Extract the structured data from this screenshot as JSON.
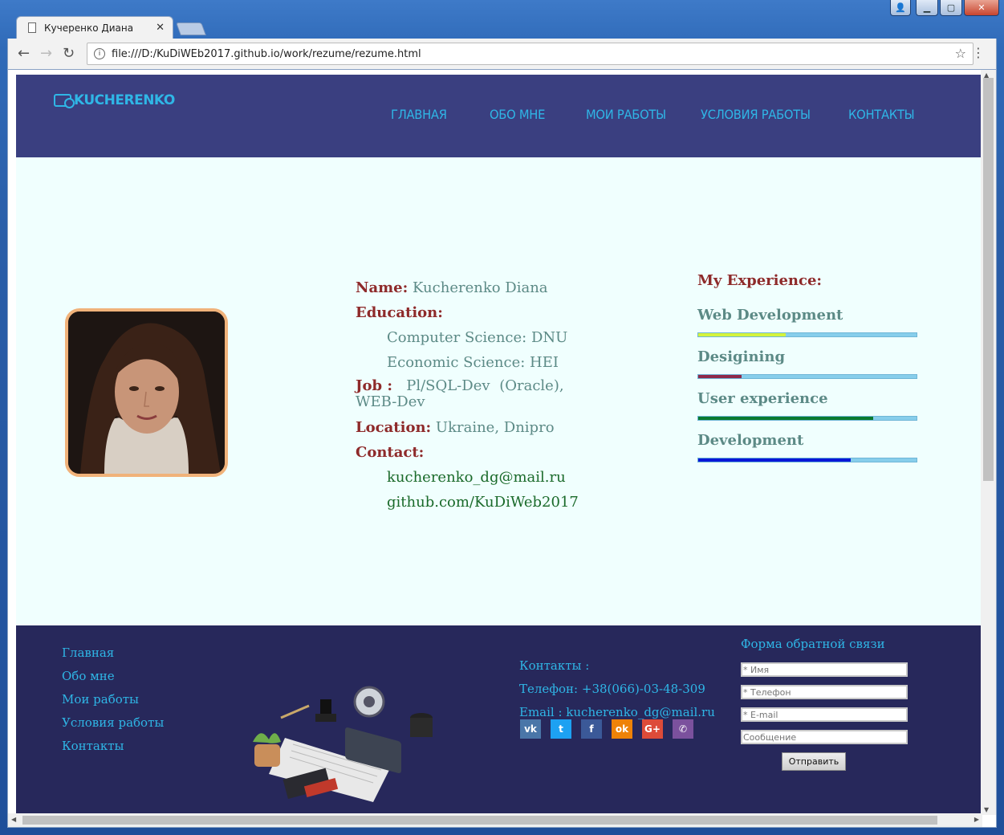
{
  "browser": {
    "tab_title": "Кучеренко Диана",
    "tab_close": "✕",
    "url": "file:///D:/KuDiWEb2017.github.io/work/rezume/rezume.html"
  },
  "header": {
    "logo_text": "KUCHERENKO",
    "menu": [
      "ГЛАВНАЯ",
      "ОБО МНЕ",
      "МОИ РАБОТЫ",
      "УСЛОВИЯ РАБОТЫ",
      "КОНТАКТЫ"
    ]
  },
  "profile": {
    "name_label": "Name:",
    "name": "Kucherenko Diana",
    "education_label": "Education:",
    "education": [
      "Computer Science: DNU",
      "Economic Science: HEI"
    ],
    "job_label": "Job :",
    "job": "Pl/SQL-Dev (Oracle), WEB-Dev",
    "location_label": "Location:",
    "location": "Ukraine, Dnipro",
    "contact_label": "Contact:",
    "email": "kucherenko_dg@mail.ru",
    "github": "github.com/KuDiWeb2017"
  },
  "experience": {
    "title": "My Experience:",
    "skills": [
      {
        "name": "Web Development",
        "level": 0.4,
        "color": "#d4f33c"
      },
      {
        "name": "Desigining",
        "level": 0.2,
        "color": "#8e2a4a"
      },
      {
        "name": "User experience",
        "level": 0.8,
        "color": "#0a7a30"
      },
      {
        "name": "Development",
        "level": 0.7,
        "color": "#0a18d8"
      }
    ],
    "track_color": "#87ceeb"
  },
  "footer": {
    "nav": [
      "Главная",
      "Обо мне",
      "Мои работы",
      "Условия работы",
      "Контакты"
    ],
    "contacts_title": "Контакты :",
    "phone": "Телефон: +38(066)-03-48-309",
    "email": "Email : kucherenko_dg@mail.ru",
    "socials": [
      {
        "icon": "vk-icon",
        "glyph": "vk",
        "color": "#4a76a8"
      },
      {
        "icon": "twitter-icon",
        "glyph": "t",
        "color": "#1da1f2"
      },
      {
        "icon": "facebook-icon",
        "glyph": "f",
        "color": "#3b5998"
      },
      {
        "icon": "odnoklassniki-icon",
        "glyph": "ok",
        "color": "#ee8208"
      },
      {
        "icon": "google-plus-icon",
        "glyph": "G+",
        "color": "#dd4b39"
      },
      {
        "icon": "viber-icon",
        "glyph": "✆",
        "color": "#7b519d"
      }
    ],
    "form_title": "Форма обратной связи",
    "placeholders": {
      "name": "* Имя",
      "phone": "* Телефон",
      "email": "* E-mail",
      "message": "Сообщение"
    },
    "submit": "Отправить"
  }
}
